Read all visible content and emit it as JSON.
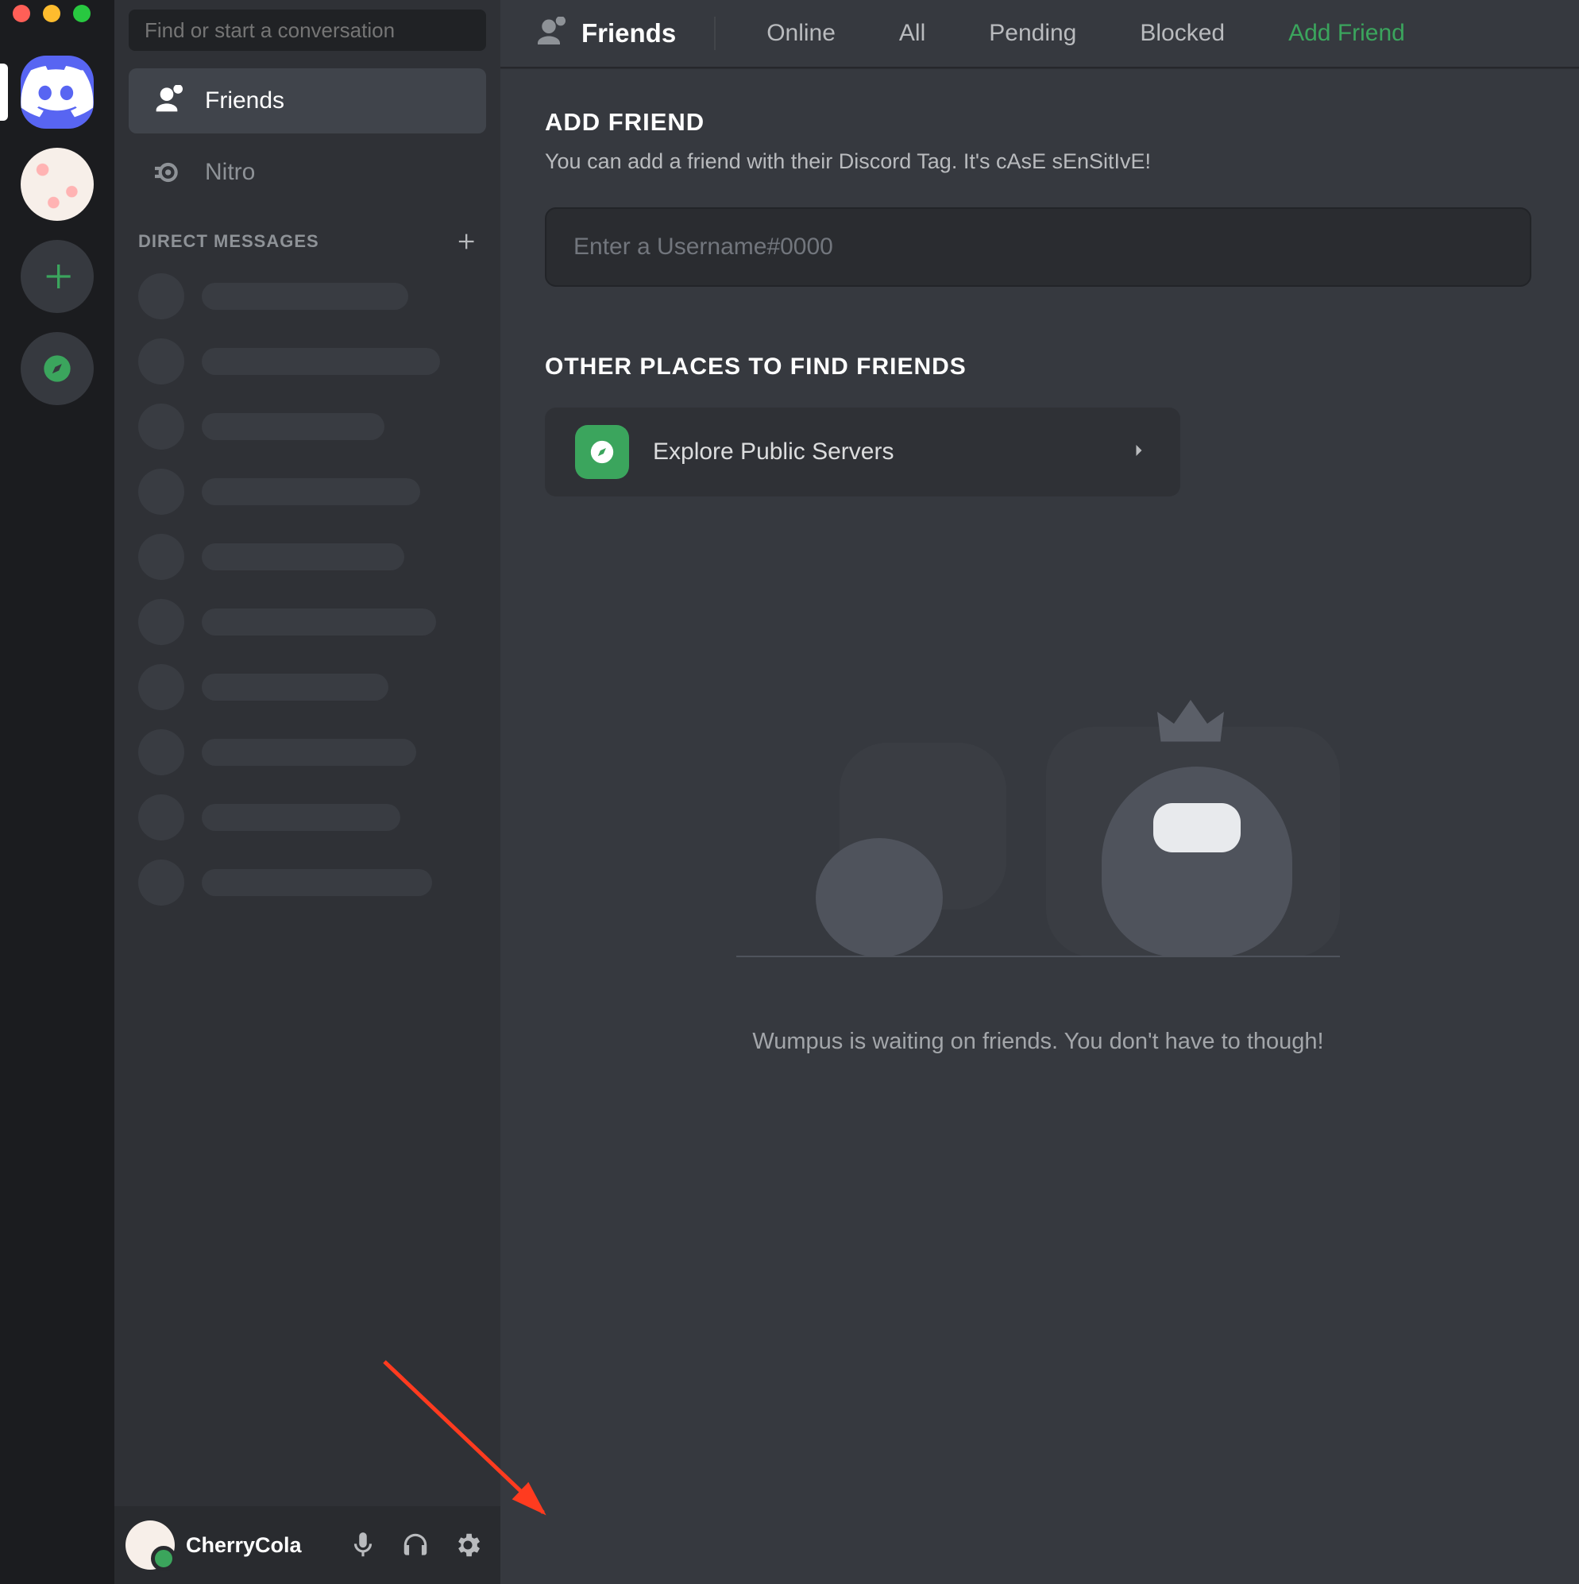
{
  "search": {
    "placeholder": "Find or start a conversation"
  },
  "nav": {
    "friends": "Friends",
    "nitro": "Nitro"
  },
  "dm_header": "DIRECT MESSAGES",
  "dm_placeholder_widths": [
    260,
    300,
    230,
    275,
    255,
    295,
    235,
    270,
    250,
    290
  ],
  "user": {
    "name": "CherryCola"
  },
  "topbar": {
    "lead": "Friends",
    "tabs": [
      "Online",
      "All",
      "Pending",
      "Blocked"
    ],
    "add_friend": "Add Friend"
  },
  "content": {
    "add_friend_header": "ADD FRIEND",
    "add_friend_sub": "You can add a friend with their Discord Tag. It's cAsE sEnSitIvE!",
    "add_friend_placeholder": "Enter a Username#0000",
    "other_places": "OTHER PLACES TO FIND FRIENDS",
    "explore": "Explore Public Servers",
    "wumpus_text": "Wumpus is waiting on friends. You don't have to though!"
  }
}
